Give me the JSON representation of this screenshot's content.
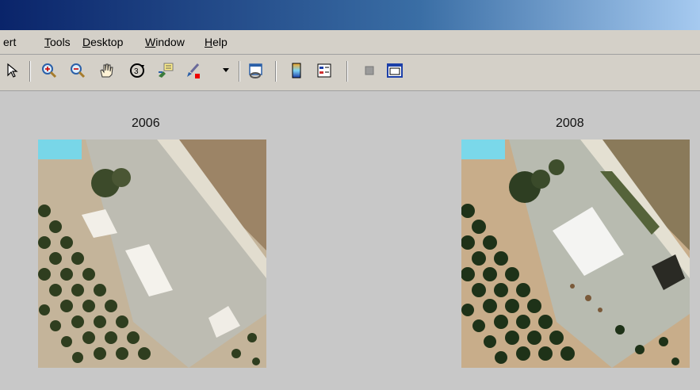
{
  "menubar": {
    "items": [
      {
        "pre": "ert",
        "u": "",
        "post": ""
      },
      {
        "pre": "",
        "u": "T",
        "post": "ools"
      },
      {
        "pre": "",
        "u": "D",
        "post": "esktop"
      },
      {
        "pre": "",
        "u": "W",
        "post": "indow"
      },
      {
        "pre": "",
        "u": "H",
        "post": "elp"
      }
    ]
  },
  "toolbar": {
    "icons": [
      "pointer-icon",
      "zoom-in-icon",
      "zoom-out-icon",
      "pan-hand-icon",
      "rotate-3d-icon",
      "data-cursor-icon",
      "brush-icon",
      "dropdown-arrow-icon",
      "link-plot-icon",
      "colorbar-icon",
      "legend-icon",
      "hide-plot-tools-icon",
      "show-plot-tools-icon"
    ]
  },
  "figure": {
    "left_title": "2006",
    "right_title": "2008"
  }
}
